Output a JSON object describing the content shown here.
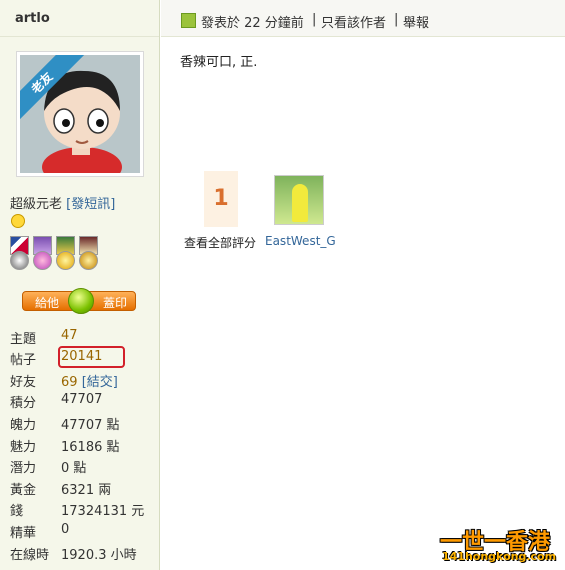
{
  "profile": {
    "username": "artlo",
    "avatar_badge": "老友",
    "rank": "超級元老",
    "pm_link": "[發短訊]",
    "give_button": {
      "left": "給他",
      "right": "蓋印"
    },
    "stats": [
      {
        "key": "主題",
        "value": "47"
      },
      {
        "key": "帖子",
        "value": "20141"
      },
      {
        "key": "好友",
        "value": "69",
        "action": "[結交]"
      },
      {
        "key": "積分",
        "value": "47707"
      },
      {
        "key": "魄力",
        "value": "47707 點"
      },
      {
        "key": "魅力",
        "value": "16186 點"
      },
      {
        "key": "潛力",
        "value": "0 點"
      },
      {
        "key": "黃金",
        "value": "6321 兩"
      },
      {
        "key": "錢",
        "value": "17324131 元"
      },
      {
        "key": "精華",
        "value": "0"
      },
      {
        "key": "在線時",
        "value": "1920.3 小時"
      }
    ]
  },
  "post": {
    "posted": "發表於 22 分鐘前",
    "author_only": "只看該作者",
    "report": "舉報",
    "separator": "|",
    "body": "香辣可口, 正.",
    "rating": {
      "count": "1",
      "link": "查看全部評分",
      "rater": "EastWest_G"
    }
  },
  "watermark": {
    "title": "一世一香港",
    "url": "141hongkong.com"
  },
  "colors": {
    "highlight": "#d2202a",
    "rating": "#d96f2e",
    "sidebar": "#f5f7ea",
    "accent_orange": "#e56f00"
  }
}
